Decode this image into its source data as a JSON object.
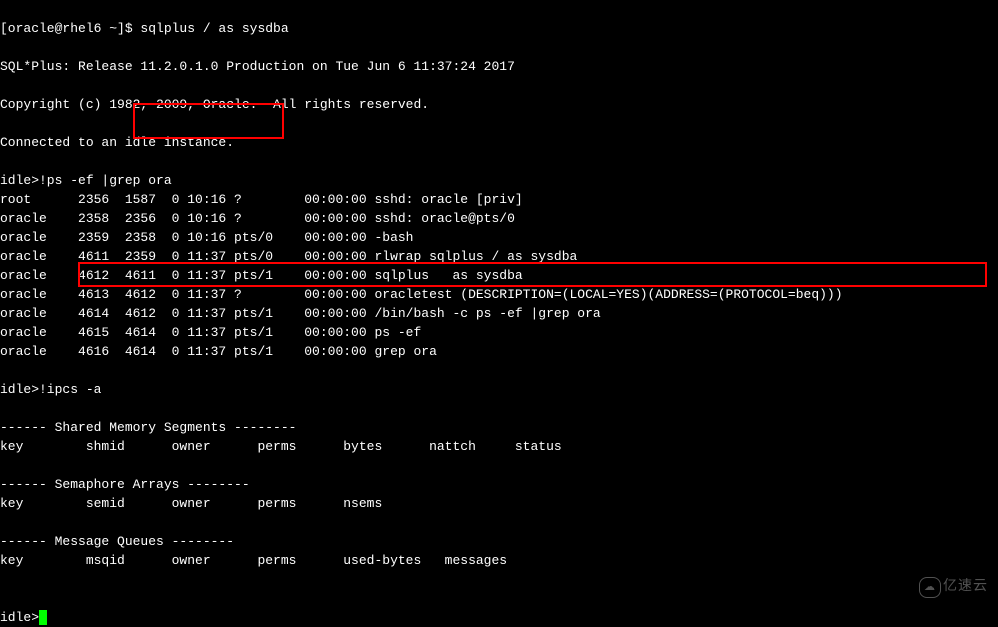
{
  "prompt_line": "[oracle@rhel6 ~]$ sqlplus / as sysdba",
  "blank": "",
  "sqlplus_banner": "SQL*Plus: Release 11.2.0.1.0 Production on Tue Jun 6 11:37:24 2017",
  "copyright": "Copyright (c) 1982, 2009, Oracle.  All rights reserved.",
  "connected": "Connected to an idle instance.",
  "cmd_ps": "idle>!ps -ef |grep ora",
  "ps_lines": {
    "l0": "root      2356  1587  0 10:16 ?        00:00:00 sshd: oracle [priv]",
    "l1": "oracle    2358  2356  0 10:16 ?        00:00:00 sshd: oracle@pts/0",
    "l2": "oracle    2359  2358  0 10:16 pts/0    00:00:00 -bash",
    "l3": "oracle    4611  2359  0 11:37 pts/0    00:00:00 rlwrap sqlplus / as sysdba",
    "l4": "oracle    4612  4611  0 11:37 pts/1    00:00:00 sqlplus   as sysdba",
    "l5": "oracle    4613  4612  0 11:37 ?        00:00:00 oracletest (DESCRIPTION=(LOCAL=YES)(ADDRESS=(PROTOCOL=beq)))",
    "l6": "oracle    4614  4612  0 11:37 pts/1    00:00:00 /bin/bash -c ps -ef |grep ora",
    "l7": "oracle    4615  4614  0 11:37 pts/1    00:00:00 ps -ef",
    "l8": "oracle    4616  4614  0 11:37 pts/1    00:00:00 grep ora"
  },
  "cmd_ipcs": "idle>!ipcs -a",
  "shm_header": "------ Shared Memory Segments --------",
  "shm_cols": "key        shmid      owner      perms      bytes      nattch     status",
  "sem_header": "------ Semaphore Arrays --------",
  "sem_cols": "key        semid      owner      perms      nsems",
  "msg_header": "------ Message Queues --------",
  "msg_cols": "key        msqid      owner      perms      used-bytes   messages",
  "idle_prompt": "idle>",
  "watermark": "亿速云"
}
